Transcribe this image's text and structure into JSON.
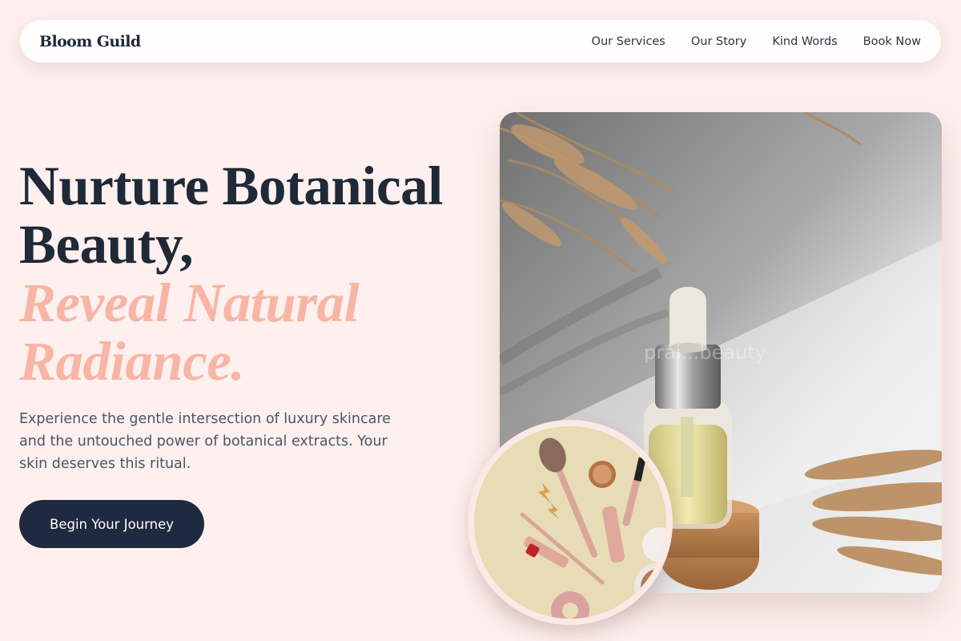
{
  "brand": {
    "name": "Bloom Guild"
  },
  "nav": {
    "links": [
      {
        "label": "Our Services"
      },
      {
        "label": "Our Story"
      },
      {
        "label": "Kind Words"
      },
      {
        "label": "Book Now"
      }
    ]
  },
  "hero": {
    "headline_line1": "Nurture Botanical",
    "headline_line2": "Beauty,",
    "accent_line1": "Reveal Natural",
    "accent_line2": "Radiance.",
    "subtext": "Experience the gentle intersection of luxury skincare and the untouched power of botanical extracts. Your skin deserves this ritual.",
    "cta_label": "Begin Your Journey"
  },
  "images": {
    "main_watermark": "prai...beauty"
  },
  "colors": {
    "background": "#fdf0ee",
    "accent": "#f8b5a5",
    "cta": "#1f2a40",
    "text": "#1f2937"
  }
}
